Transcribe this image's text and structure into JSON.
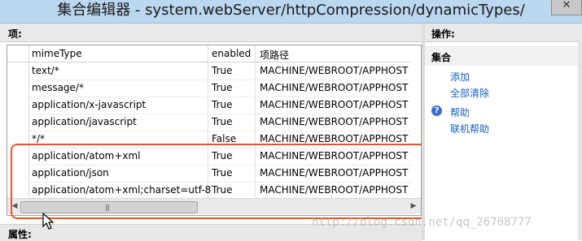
{
  "window": {
    "title": "集合编辑器 - system.webServer/httpCompression/dynamicTypes/",
    "close_label": "✕"
  },
  "items_panel": {
    "header": "项:",
    "columns": [
      "mimeType",
      "enabled",
      "项路径"
    ],
    "rows": [
      {
        "mimeType": "text/*",
        "enabled": "True",
        "path": "MACHINE/WEBROOT/APPHOST"
      },
      {
        "mimeType": "message/*",
        "enabled": "True",
        "path": "MACHINE/WEBROOT/APPHOST"
      },
      {
        "mimeType": "application/x-javascript",
        "enabled": "True",
        "path": "MACHINE/WEBROOT/APPHOST"
      },
      {
        "mimeType": "application/javascript",
        "enabled": "True",
        "path": "MACHINE/WEBROOT/APPHOST"
      },
      {
        "mimeType": "*/*",
        "enabled": "False",
        "path": "MACHINE/WEBROOT/APPHOST"
      },
      {
        "mimeType": "application/atom+xml",
        "enabled": "True",
        "path": "MACHINE/WEBROOT/APPHOST"
      },
      {
        "mimeType": "application/json",
        "enabled": "True",
        "path": "MACHINE/WEBROOT/APPHOST"
      },
      {
        "mimeType": "application/atom+xml;charset=utf-8",
        "enabled": "True",
        "path": "MACHINE/WEBROOT/APPHOST"
      }
    ],
    "scroll_grip": "|||"
  },
  "properties_panel": {
    "header": "属性:"
  },
  "actions_panel": {
    "header": "操作:",
    "section_title": "集合",
    "links": [
      "添加",
      "全部清除"
    ],
    "help_icon": "?",
    "help_links": [
      "帮助",
      "联机帮助"
    ]
  },
  "watermark": "http://blog.csdn.net/qq_26708777",
  "colors": {
    "highlight": "#e4572e",
    "link": "#1560bd",
    "titlebar": "#bcd7f0"
  }
}
